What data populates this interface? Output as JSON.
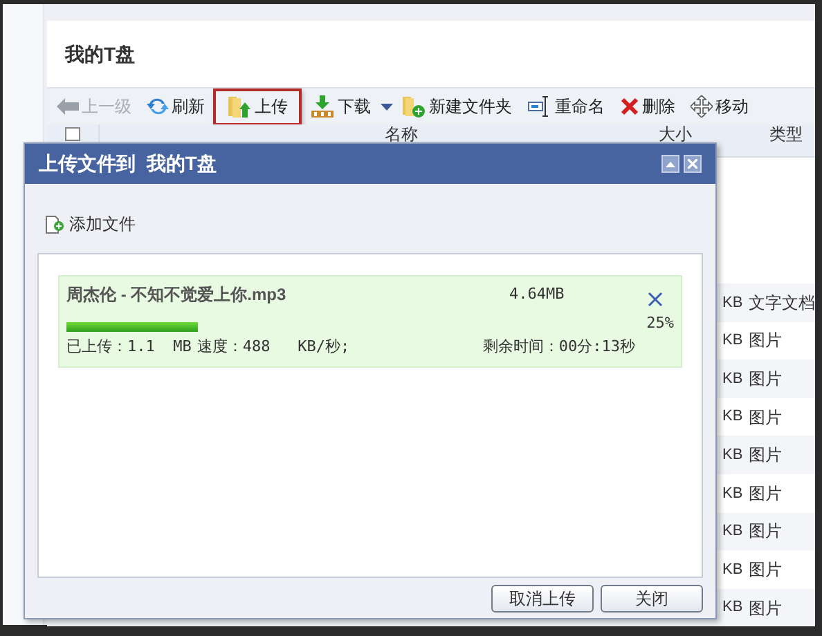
{
  "page": {
    "title": "我的T盘"
  },
  "toolbar": [
    {
      "label": "上一级",
      "kind": "up",
      "disabled": true,
      "selected": false
    },
    {
      "label": "刷新",
      "kind": "refresh",
      "disabled": false,
      "selected": false
    },
    {
      "label": "上传",
      "kind": "upload",
      "disabled": false,
      "selected": true
    },
    {
      "label": "下载",
      "kind": "download",
      "disabled": false,
      "selected": false
    },
    {
      "label": "新建文件夹",
      "kind": "new-folder",
      "disabled": false,
      "selected": false
    },
    {
      "label": "重命名",
      "kind": "rename",
      "disabled": false,
      "selected": false
    },
    {
      "label": "删除",
      "kind": "delete",
      "disabled": false,
      "selected": false
    },
    {
      "label": "移动",
      "kind": "move",
      "disabled": false,
      "selected": false
    }
  ],
  "table": {
    "select_all": {
      "checked": false
    },
    "columns": [
      "名称",
      "大小",
      "类型"
    ],
    "rows": [
      {
        "size": "KB",
        "type": "文字文档"
      },
      {
        "size": "KB",
        "type": "图片"
      },
      {
        "size": "KB",
        "type": "图片"
      },
      {
        "size": "KB",
        "type": "图片"
      },
      {
        "size": "KB",
        "type": "图片"
      },
      {
        "size": "KB",
        "type": "图片"
      },
      {
        "size": "KB",
        "type": "图片"
      },
      {
        "size": "KB",
        "type": "图片"
      },
      {
        "size": "KB",
        "type": "图片"
      }
    ]
  },
  "dialog": {
    "title": "上传文件到  我的T盘",
    "add_file": "添加文件",
    "upload": {
      "name": "周杰伦 - 不知不觉爱上你.mp3",
      "size": "4.64MB",
      "level": 0.25,
      "percent": "25%",
      "uploaded": "已上传：1.1  MB",
      "speed": "速度：488   KB/秒;",
      "remaining": "剩余时间：00分:13秒"
    },
    "buttons": [
      "取消上传",
      "关闭"
    ]
  }
}
